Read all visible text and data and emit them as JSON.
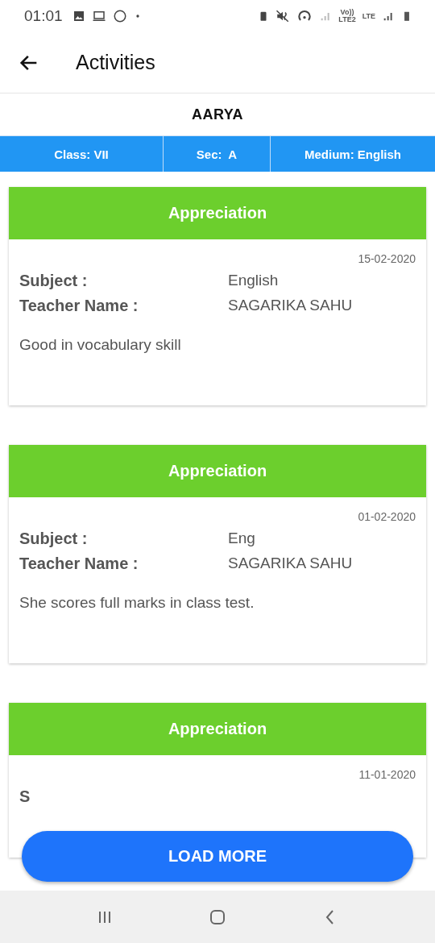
{
  "status_bar": {
    "time": "01:01",
    "network_labels": [
      "Vo))",
      "LTE2",
      "LTE"
    ]
  },
  "app_bar": {
    "title": "Activities"
  },
  "student": {
    "name": "AARYA"
  },
  "info_bar": [
    "Class: VII",
    "Sec:  A",
    "Medium: English"
  ],
  "activities": [
    {
      "type": "Appreciation",
      "date": "15-02-2020",
      "subject_label": "Subject :",
      "subject": "English",
      "teacher_label": "Teacher Name :",
      "teacher": "SAGARIKA SAHU",
      "remark": "Good in vocabulary skill"
    },
    {
      "type": "Appreciation",
      "date": "01-02-2020",
      "subject_label": "Subject :",
      "subject": "Eng",
      "teacher_label": "Teacher Name :",
      "teacher": "SAGARIKA SAHU",
      "remark": "She scores full marks in class test."
    },
    {
      "type": "Appreciation",
      "date": "11-01-2020",
      "subject_label": "S"
    }
  ],
  "load_more": "LOAD MORE"
}
